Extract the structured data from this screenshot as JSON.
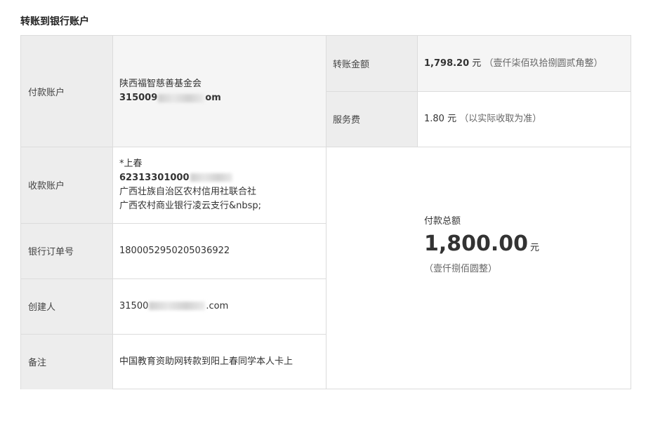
{
  "title": "转账到银行账户",
  "payer": {
    "label": "付款账户",
    "name": "陕西福智慈善基金会",
    "account_start": "315009",
    "account_end": "om"
  },
  "payee": {
    "label": "收款账户",
    "name": "*上春",
    "account_start": "62313301000",
    "bank": "广西壮族自治区农村信用社联合社",
    "branch": "广西农村商业银行凌云支行&nbsp;"
  },
  "order": {
    "label": "银行订单号",
    "value": "1800052950205036922"
  },
  "creator": {
    "label": "创建人",
    "value_start": "31500",
    "value_end": ".com"
  },
  "memo": {
    "label": "备注",
    "value": "中国教育资助网转款到阳上春同学本人卡上"
  },
  "amount": {
    "label": "转账金额",
    "value": "1,798.20",
    "unit": "元",
    "words": "（壹仟柒佰玖拾捌圆贰角整）"
  },
  "fee": {
    "label": "服务费",
    "value": "1.80",
    "unit": "元",
    "note": "（以实际收取为准）"
  },
  "total": {
    "label": "付款总额",
    "value": "1,800.00",
    "unit": "元",
    "words": "（壹仟捌佰圆整）"
  }
}
